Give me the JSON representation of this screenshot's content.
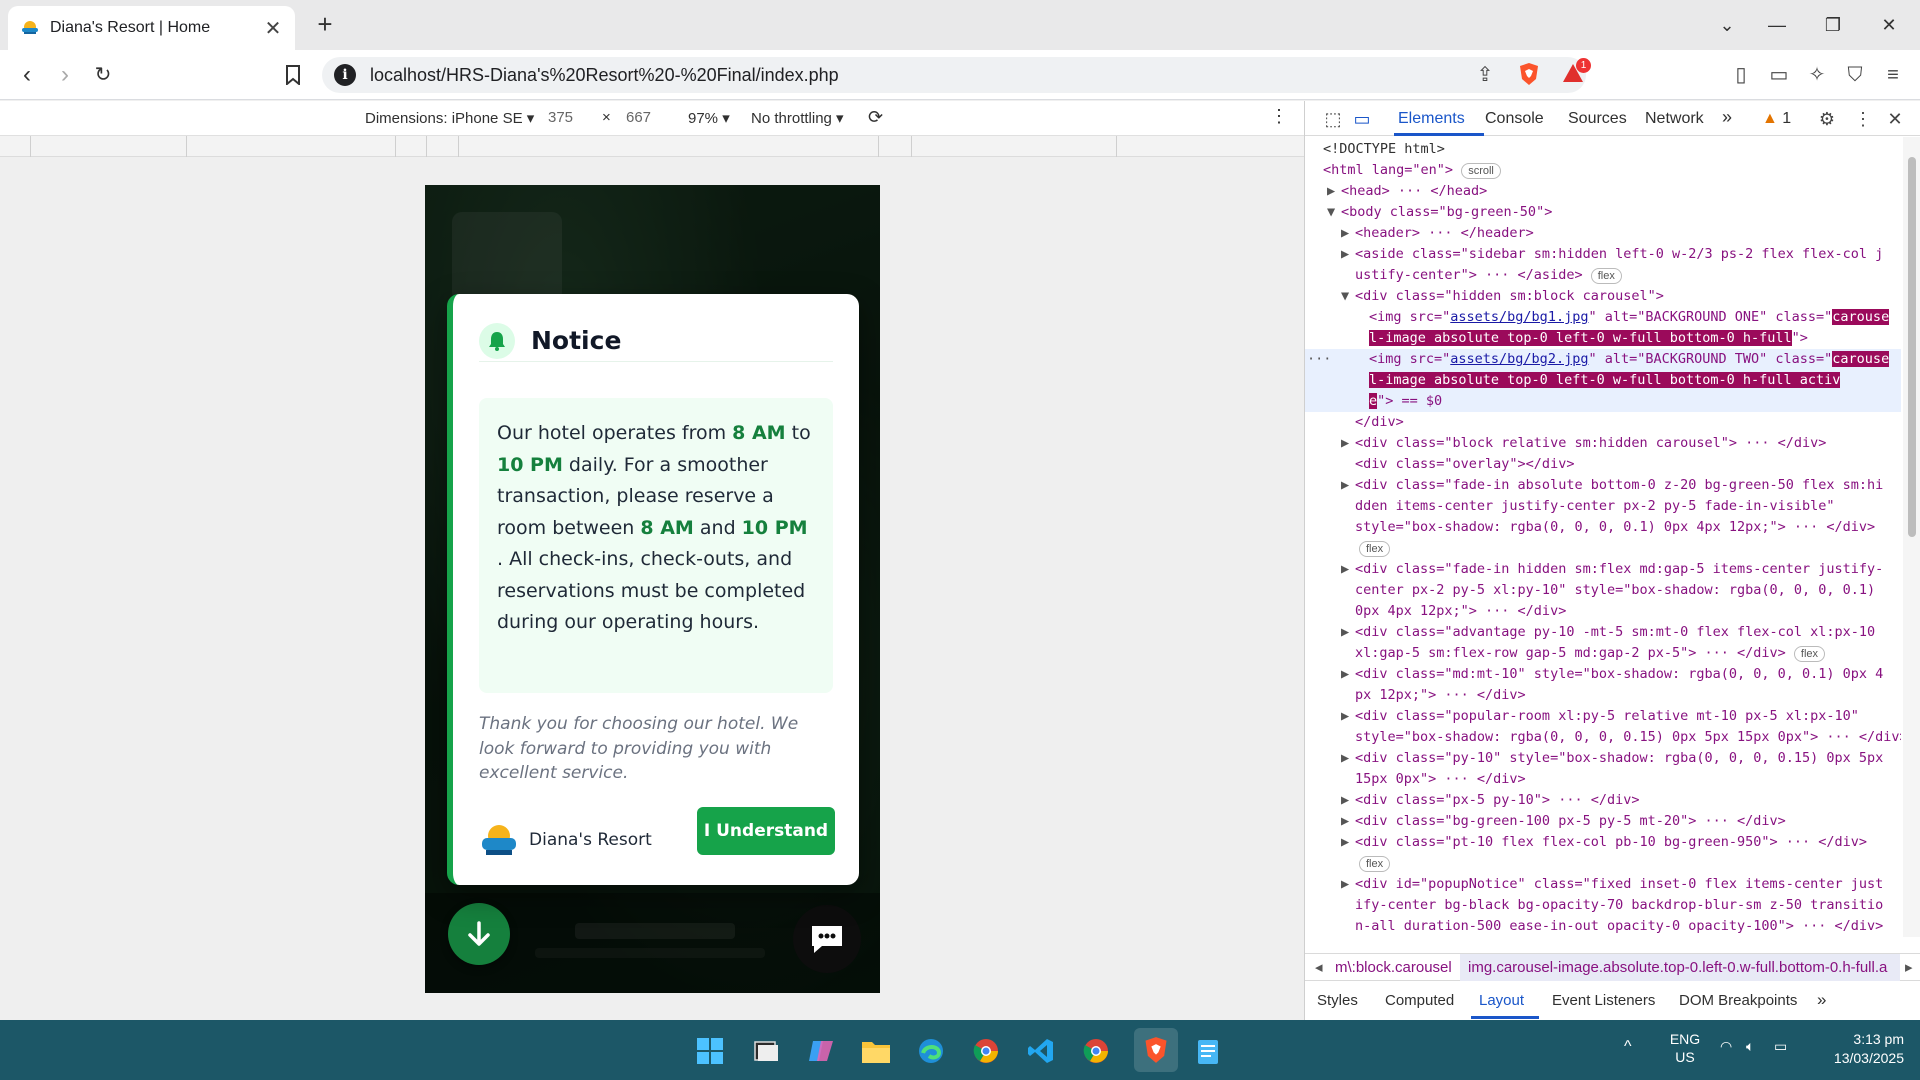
{
  "browser": {
    "tab_title": "Diana's Resort | Home",
    "tab_close": "✕",
    "new_tab": "+",
    "url": "localhost/HRS-Diana's%20Resort%20-%20Final/index.php",
    "notification_count": "1"
  },
  "device_toolbar": {
    "dimensions_label": "Dimensions: iPhone SE",
    "width": "375",
    "times": "×",
    "height": "667",
    "zoom": "97%",
    "throttling": "No throttling"
  },
  "notice": {
    "heading": "Notice",
    "msg_1": "Our hotel operates from ",
    "t1": "8 AM",
    "msg_2": " to ",
    "t2": "10 PM",
    "msg_3": " daily. For a smoother transaction, please reserve a room between ",
    "t3": "8 AM",
    "msg_4": " and ",
    "t4": "10 PM",
    "msg_5": " . All check-ins, check-outs, and reservations must be completed during our operating hours.",
    "thanks": "Thank you for choosing our hotel. We look forward to providing you with excellent service.",
    "brand_name": "Diana's Resort",
    "button_label": "I Understand"
  },
  "devtools": {
    "tabs": [
      "Elements",
      "Console",
      "Sources",
      "Network"
    ],
    "more": "»",
    "issues_count": "1",
    "breadcrumb_1": "m\\:block.carousel",
    "breadcrumb_2": "img.carousel-image.absolute.top-0.left-0.w-full.bottom-0.h-full.a",
    "side_tabs": [
      "Styles",
      "Computed",
      "Layout",
      "Event Listeners",
      "DOM Breakpoints"
    ],
    "dom": {
      "doctype": "<!DOCTYPE html>",
      "html_open": "<html lang=\"en\">",
      "scroll_badge": "scroll",
      "head": "<head> ··· </head>",
      "body_open": "<body class=\"bg-green-50\">",
      "header": "<header> ··· </header>",
      "aside_1": "<aside class=\"sidebar sm:hidden left-0 w-2/3 ps-2 flex flex-col j",
      "aside_2": "ustify-center\"> ··· </aside>",
      "flex_badge": "flex",
      "carousel_div": "<div class=\"hidden sm:block carousel\">",
      "img1_1a": "<img src=\"",
      "img1_src": "assets/bg/bg1.jpg",
      "img1_1b": "\" alt=\"BACKGROUND ONE\" class=\"",
      "img1_cls1": "carouse",
      "img1_cls2": "l-image absolute top-0 left-0 w-full bottom-0 h-full",
      "img1_end": "\">",
      "img2_1a": "<img src=\"",
      "img2_src": "assets/bg/bg2.jpg",
      "img2_1b": "\" alt=\"BACKGROUND TWO\" class=\"",
      "img2_cls1": "carouse",
      "img2_cls2": "l-image absolute top-0 left-0 w-full bottom-0 h-full activ",
      "img2_cls3": "e",
      "img2_end": "\"> == $0",
      "div_close": "</div>",
      "block_carousel": "<div class=\"block relative sm:hidden carousel\"> ··· </div>",
      "overlay": "<div class=\"overlay\"></div>",
      "fade1_1": "<div class=\"fade-in absolute bottom-0 z-20 bg-green-50 flex sm:hi",
      "fade1_2": "dden items-center justify-center px-2 py-5 fade-in-visible\"",
      "fade1_3": "style=\"box-shadow: rgba(0, 0, 0, 0.1) 0px 4px 12px;\"> ··· </div>",
      "fade2_1": "<div class=\"fade-in hidden sm:flex md:gap-5 items-center justify-",
      "fade2_2": "center px-2 py-5 xl:py-10\" style=\"box-shadow: rgba(0, 0, 0, 0.1)",
      "fade2_3": "0px 4px 12px;\"> ··· </div>",
      "adv_1": "<div class=\"advantage py-10 -mt-5 sm:mt-0 flex flex-col xl:px-10",
      "adv_2": "xl:gap-5 sm:flex-row gap-5 md:gap-2 px-5\"> ··· </div>",
      "md_1": "<div class=\"md:mt-10\" style=\"box-shadow: rgba(0, 0, 0, 0.1) 0px 4",
      "md_2": "px 12px;\"> ··· </div>",
      "pop_1": "<div class=\"popular-room xl:py-5 relative mt-10 px-5 xl:px-10\"",
      "pop_2": "style=\"box-shadow: rgba(0, 0, 0, 0.15) 0px 5px 15px 0px\"> ··· </div>",
      "py_1": "<div class=\"py-10\" style=\"box-shadow: rgba(0, 0, 0, 0.15) 0px 5px",
      "py_2": "15px 0px\"> ··· </div>",
      "px5": "<div class=\"px-5 py-10\"> ··· </div>",
      "bg100": "<div class=\"bg-green-100 px-5 py-5 mt-20\"> ··· </div>",
      "pt10": "<div class=\"pt-10 flex flex-col pb-10 bg-green-950\"> ··· </div>",
      "popup_1": "<div id=\"popupNotice\" class=\"fixed inset-0 flex items-center just",
      "popup_2": "ify-center bg-black bg-opacity-70 backdrop-blur-sm z-50 transitio",
      "popup_3": "n-all duration-500 ease-in-out opacity-0 opacity-100\"> ··· </div>"
    }
  },
  "taskbar": {
    "lang_1": "ENG",
    "lang_2": "US",
    "time": "3:13 pm",
    "date": "13/03/2025"
  }
}
